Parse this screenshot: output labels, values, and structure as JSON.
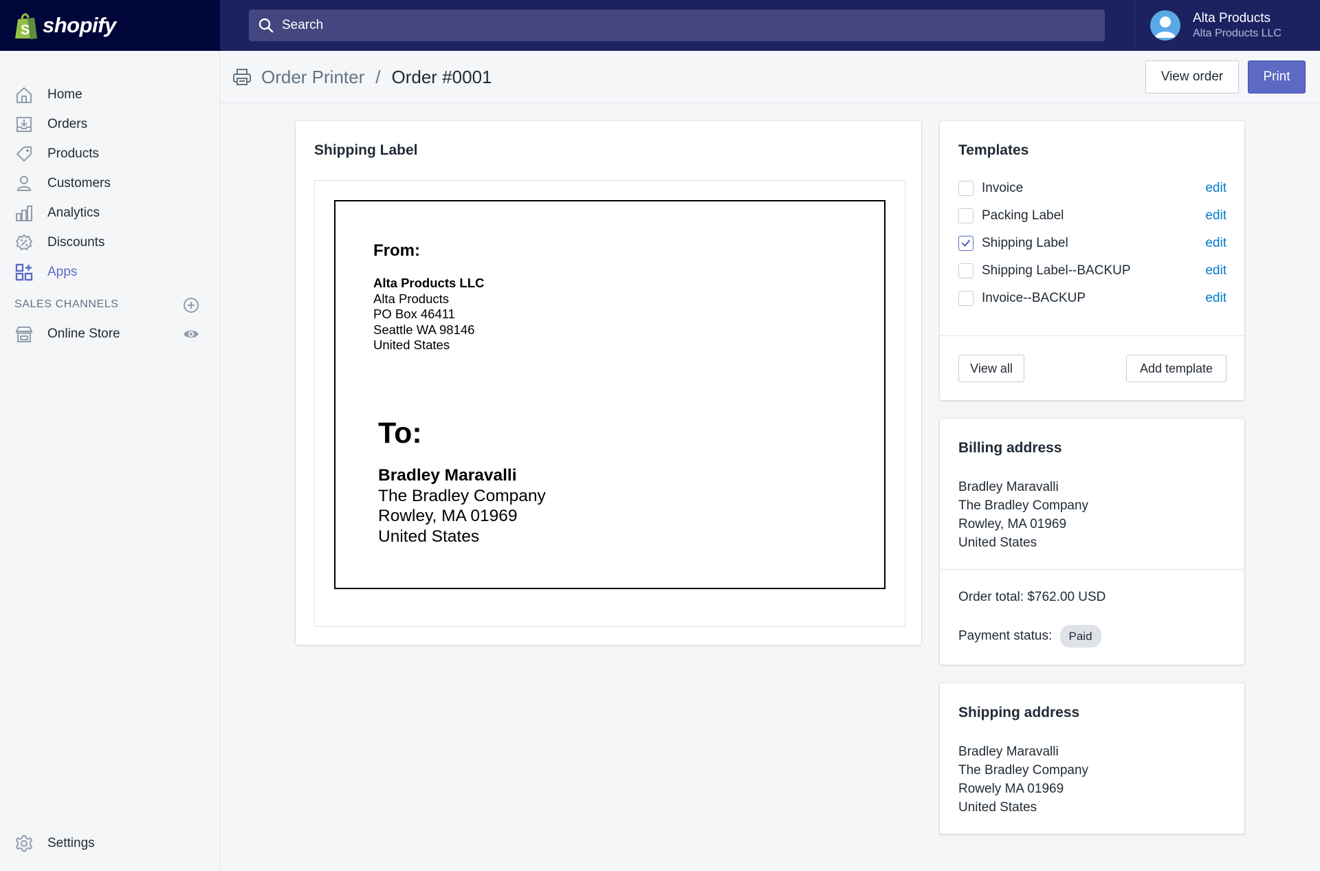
{
  "brand": {
    "name": "shopify"
  },
  "search": {
    "placeholder": "Search"
  },
  "user": {
    "name": "Alta Products",
    "org": "Alta Products LLC"
  },
  "sidebar": {
    "items": [
      {
        "label": "Home",
        "icon": "home-icon"
      },
      {
        "label": "Orders",
        "icon": "orders-icon"
      },
      {
        "label": "Products",
        "icon": "tag-icon"
      },
      {
        "label": "Customers",
        "icon": "person-icon"
      },
      {
        "label": "Analytics",
        "icon": "bar-chart-icon"
      },
      {
        "label": "Discounts",
        "icon": "discount-icon"
      },
      {
        "label": "Apps",
        "icon": "apps-icon",
        "active": true
      }
    ],
    "sales_channels_title": "SALES CHANNELS",
    "channels": [
      {
        "label": "Online Store",
        "icon": "store-icon"
      }
    ],
    "settings_label": "Settings"
  },
  "header": {
    "app_name": "Order Printer",
    "separator": "/",
    "current": "Order #0001",
    "view_order_label": "View order",
    "print_label": "Print"
  },
  "preview": {
    "title": "Shipping Label",
    "from_heading": "From:",
    "from_lines": [
      "Alta Products LLC",
      "Alta Products",
      "PO Box 46411",
      "Seattle WA 98146",
      "United States"
    ],
    "to_heading": "To:",
    "to_lines": [
      "Bradley Maravalli",
      "The Bradley Company",
      "Rowley, MA 01969",
      "United States"
    ]
  },
  "templates": {
    "title": "Templates",
    "items": [
      {
        "label": "Invoice",
        "checked": false,
        "edit": "edit"
      },
      {
        "label": "Packing Label",
        "checked": false,
        "edit": "edit"
      },
      {
        "label": "Shipping Label",
        "checked": true,
        "edit": "edit"
      },
      {
        "label": "Shipping Label--BACKUP",
        "checked": false,
        "edit": "edit"
      },
      {
        "label": "Invoice--BACKUP",
        "checked": false,
        "edit": "edit"
      }
    ],
    "view_all_label": "View all",
    "add_template_label": "Add template"
  },
  "billing": {
    "title": "Billing address",
    "lines": [
      "Bradley Maravalli",
      "The Bradley Company",
      "Rowley, MA 01969",
      "United States"
    ],
    "order_total_label": "Order total:",
    "order_total_value": "$762.00 USD",
    "payment_status_label": "Payment status:",
    "payment_status_value": "Paid"
  },
  "shipping": {
    "title": "Shipping address",
    "lines": [
      "Bradley Maravalli",
      "The Bradley Company",
      "Rowely MA 01969",
      "United States"
    ]
  },
  "colors": {
    "topbar": "#1c2260",
    "logo_bg": "#000639",
    "accent": "#5c6ac4",
    "link": "#007ace",
    "shopify_green": "#95bf47"
  }
}
